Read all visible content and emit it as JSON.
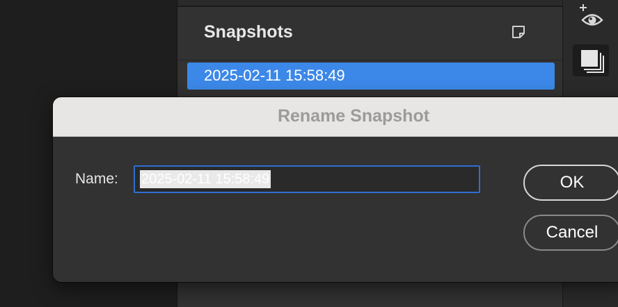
{
  "panel": {
    "title": "Snapshots",
    "new_snapshot_icon": "new-document-icon",
    "items": [
      {
        "label": "2025-02-11 15:58:49",
        "selected": true
      }
    ]
  },
  "toolbar": {
    "icons": [
      "add-eye-icon",
      "layers-icon"
    ]
  },
  "dialog": {
    "title": "Rename Snapshot",
    "name_label": "Name:",
    "name_value": "2025-02-11 15:58:49",
    "ok_label": "OK",
    "cancel_label": "Cancel"
  },
  "colors": {
    "accent": "#3c88e8",
    "input_focus_border": "#2f6fd3",
    "dialog_bg": "#323232",
    "titlebar_bg": "#e8e6e4"
  }
}
